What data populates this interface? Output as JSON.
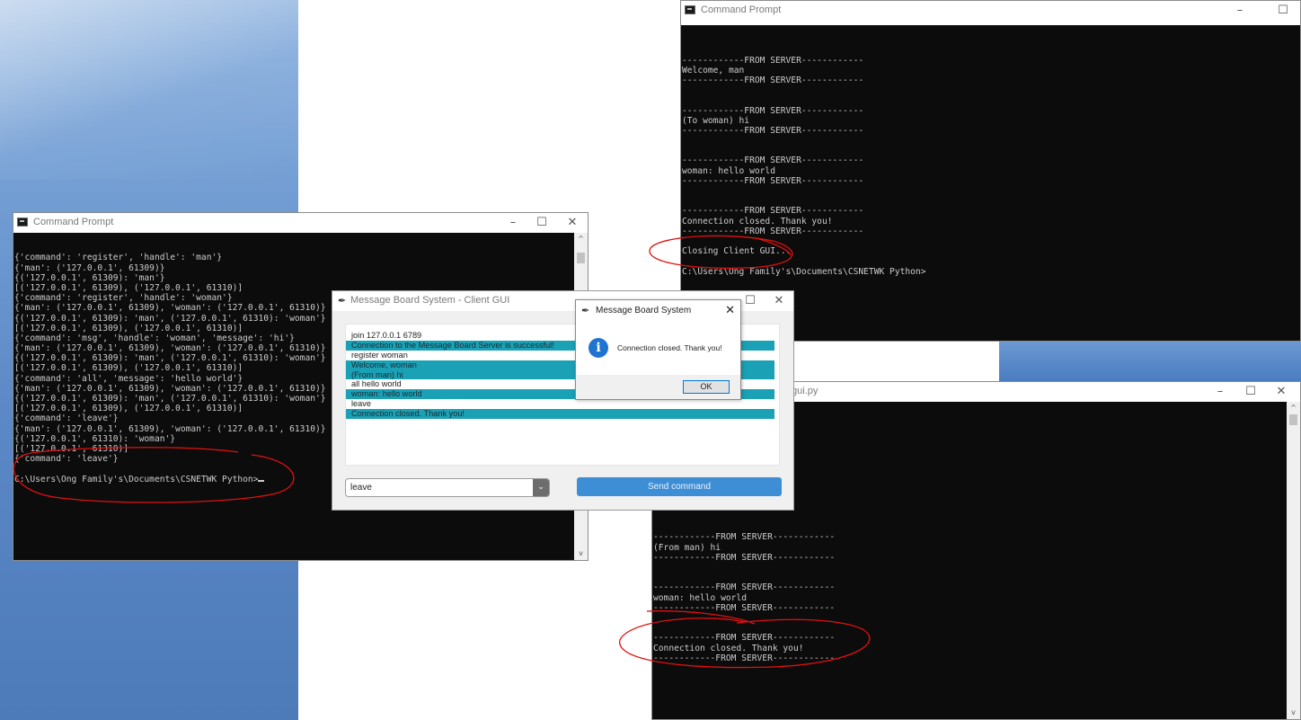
{
  "colors": {
    "console_bg": "#0c0c0c",
    "console_text": "#cccccc",
    "highlight": "#1aa1b5",
    "send_button": "#3e8ed6",
    "annotation": "#e01010"
  },
  "left_console": {
    "title": "Command Prompt",
    "minimize_glyph": "–",
    "maximize_glyph": "☐",
    "close_glyph": "✕",
    "lines": [
      "{'command': 'register', 'handle': 'man'}",
      "{'man': ('127.0.0.1', 61309)}",
      "{('127.0.0.1', 61309): 'man'}",
      "[('127.0.0.1', 61309), ('127.0.0.1', 61310)]",
      "{'command': 'register', 'handle': 'woman'}",
      "{'man': ('127.0.0.1', 61309), 'woman': ('127.0.0.1', 61310)}",
      "{('127.0.0.1', 61309): 'man', ('127.0.0.1', 61310): 'woman'}",
      "[('127.0.0.1', 61309), ('127.0.0.1', 61310)]",
      "{'command': 'msg', 'handle': 'woman', 'message': 'hi'}",
      "{'man': ('127.0.0.1', 61309), 'woman': ('127.0.0.1', 61310)}",
      "{('127.0.0.1', 61309): 'man', ('127.0.0.1', 61310): 'woman'}",
      "[('127.0.0.1', 61309), ('127.0.0.1', 61310)]",
      "{'command': 'all', 'message': 'hello world'}",
      "{'man': ('127.0.0.1', 61309), 'woman': ('127.0.0.1', 61310)}",
      "{('127.0.0.1', 61309): 'man', ('127.0.0.1', 61310): 'woman'}",
      "[('127.0.0.1', 61309), ('127.0.0.1', 61310)]",
      "{'command': 'leave'}",
      "{'man': ('127.0.0.1', 61309), 'woman': ('127.0.0.1', 61310)}",
      "{('127.0.0.1', 61310): 'woman'}",
      "[('127.0.0.1', 61310)]",
      "{'command': 'leave'}",
      "",
      "C:\\Users\\Ong Family's\\Documents\\CSNETWK Python>"
    ]
  },
  "top_right_console": {
    "title": "Command Prompt",
    "minimize_glyph": "–",
    "maximize_glyph": "☐",
    "lines": [
      "",
      "------------FROM SERVER------------",
      "Welcome, man",
      "------------FROM SERVER------------",
      "",
      "",
      "------------FROM SERVER------------",
      "(To woman) hi",
      "------------FROM SERVER------------",
      "",
      "",
      "------------FROM SERVER------------",
      "woman: hello world",
      "------------FROM SERVER------------",
      "",
      "",
      "------------FROM SERVER------------",
      "Connection closed. Thank you!",
      "------------FROM SERVER------------",
      "",
      "Closing Client GUI...",
      "",
      "C:\\Users\\Ong Family's\\Documents\\CSNETWK Python>"
    ]
  },
  "bottom_right_console": {
    "title": "gui.py",
    "minimize_glyph": "–",
    "maximize_glyph": "☐",
    "close_glyph": "✕",
    "lines": [
      "",
      "------------",
      "oard Server is successful!",
      "",
      "",
      "------------",
      "",
      "",
      "------------",
      "",
      "",
      "------------FROM SERVER------------",
      "(From man) hi",
      "------------FROM SERVER------------",
      "",
      "",
      "------------FROM SERVER------------",
      "woman: hello world",
      "------------FROM SERVER------------",
      "",
      "",
      "------------FROM SERVER------------",
      "Connection closed. Thank you!",
      "------------FROM SERVER------------"
    ]
  },
  "gui": {
    "title": "Message Board System - Client GUI",
    "maximize_glyph": "☐",
    "close_glyph": "✕",
    "log": [
      {
        "text": "join 127.0.0.1 6789",
        "highlight": false
      },
      {
        "text": "Connection to the Message Board Server is successful!",
        "highlight": true
      },
      {
        "text": "register woman",
        "highlight": false
      },
      {
        "text": "Welcome, woman",
        "highlight": true
      },
      {
        "text": "(From man) hi",
        "highlight": true
      },
      {
        "text": "all hello world",
        "highlight": false
      },
      {
        "text": "woman: hello world",
        "highlight": true
      },
      {
        "text": "leave",
        "highlight": false
      },
      {
        "text": "Connection closed. Thank you!",
        "highlight": true
      }
    ],
    "command_value": "leave",
    "dropdown_glyph": "⌄",
    "send_label": "Send command"
  },
  "dialog": {
    "title": "Message Board System",
    "close_glyph": "✕",
    "icon_glyph": "i",
    "message": "Connection closed. Thank you!",
    "ok_label": "OK"
  },
  "scroll": {
    "up_glyph": "^",
    "down_glyph": "v"
  }
}
